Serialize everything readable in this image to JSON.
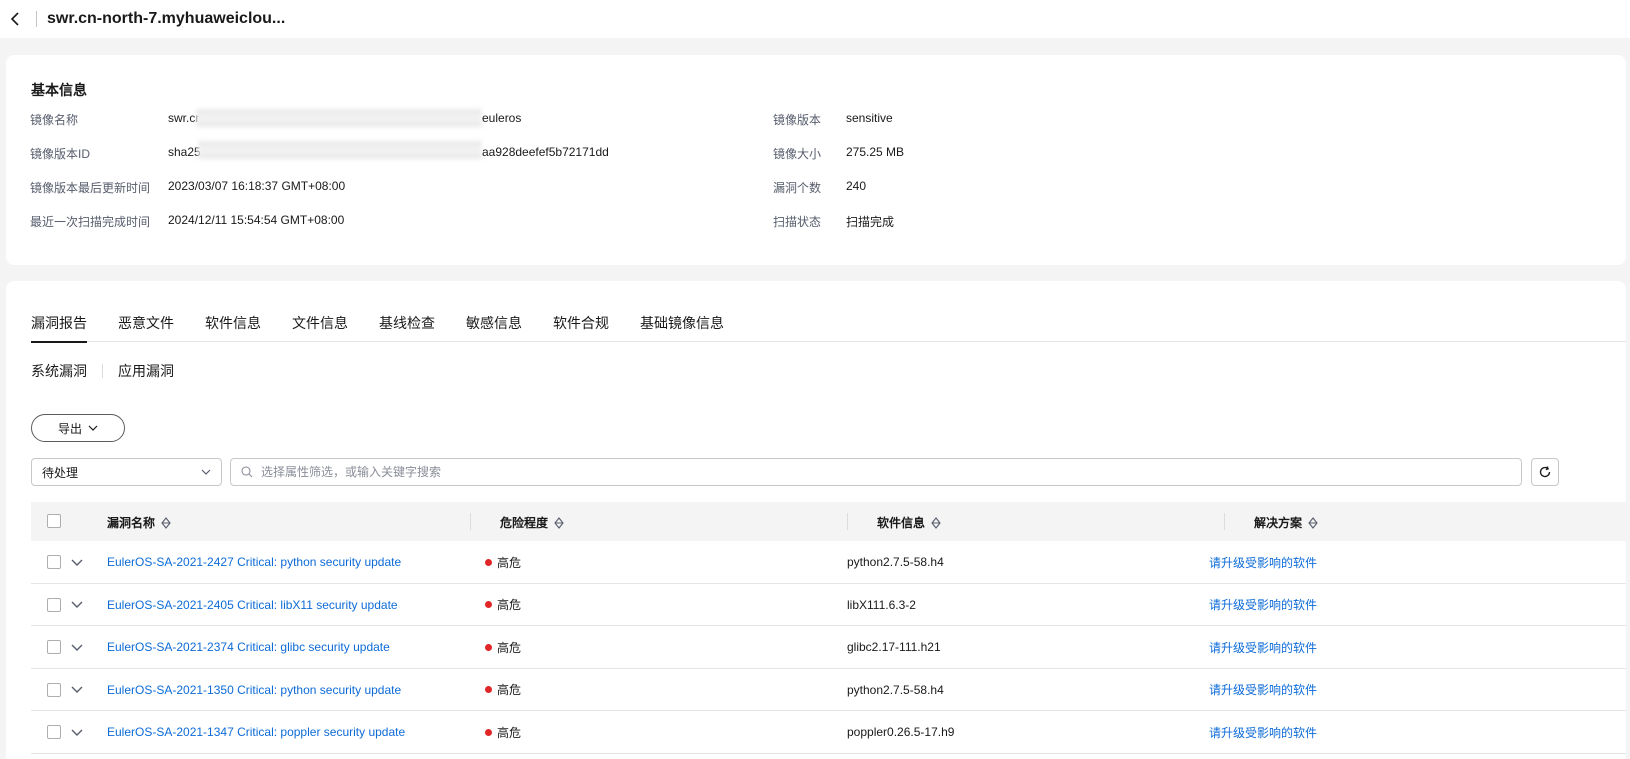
{
  "header": {
    "title": "swr.cn-north-7.myhuaweiclou..."
  },
  "basic_info": {
    "section_title": "基本信息",
    "left": [
      {
        "label": "镜像名称",
        "value_prefix": "swr.cr",
        "value_suffix": "euleros"
      },
      {
        "label": "镜像版本ID",
        "value_prefix": "sha25",
        "value_suffix": "aa928deefef5b72171dd"
      },
      {
        "label": "镜像版本最后更新时间",
        "value": "2023/03/07 16:18:37 GMT+08:00"
      },
      {
        "label": "最近一次扫描完成时间",
        "value": "2024/12/11 15:54:54 GMT+08:00"
      }
    ],
    "right": [
      {
        "label": "镜像版本",
        "value": "sensitive"
      },
      {
        "label": "镜像大小",
        "value": "275.25 MB"
      },
      {
        "label": "漏洞个数",
        "value": "240"
      },
      {
        "label": "扫描状态",
        "value": "扫描完成"
      }
    ]
  },
  "tabs": [
    "漏洞报告",
    "恶意文件",
    "软件信息",
    "文件信息",
    "基线检查",
    "敏感信息",
    "软件合规",
    "基础镜像信息"
  ],
  "subtabs": [
    "系统漏洞",
    "应用漏洞"
  ],
  "toolbar": {
    "export_label": "导出",
    "filter_value": "待处理",
    "search_placeholder": "选择属性筛选，或输入关键字搜索"
  },
  "table": {
    "columns": [
      "漏洞名称",
      "危险程度",
      "软件信息",
      "解决方案"
    ],
    "rows": [
      {
        "name": "EulerOS-SA-2021-2427 Critical: python security update",
        "severity": "高危",
        "software": "python2.7.5-58.h4",
        "solution": "请升级受影响的软件"
      },
      {
        "name": "EulerOS-SA-2021-2405 Critical: libX11 security update",
        "severity": "高危",
        "software": "libX111.6.3-2",
        "solution": "请升级受影响的软件"
      },
      {
        "name": "EulerOS-SA-2021-2374 Critical: glibc security update",
        "severity": "高危",
        "software": "glibc2.17-111.h21",
        "solution": "请升级受影响的软件"
      },
      {
        "name": "EulerOS-SA-2021-1350 Critical: python security update",
        "severity": "高危",
        "software": "python2.7.5-58.h4",
        "solution": "请升级受影响的软件"
      },
      {
        "name": "EulerOS-SA-2021-1347 Critical: poppler security update",
        "severity": "高危",
        "software": "poppler0.26.5-17.h9",
        "solution": "请升级受影响的软件"
      }
    ]
  },
  "colors": {
    "link": "#0d6bd8",
    "severity_high": "#e02626"
  }
}
